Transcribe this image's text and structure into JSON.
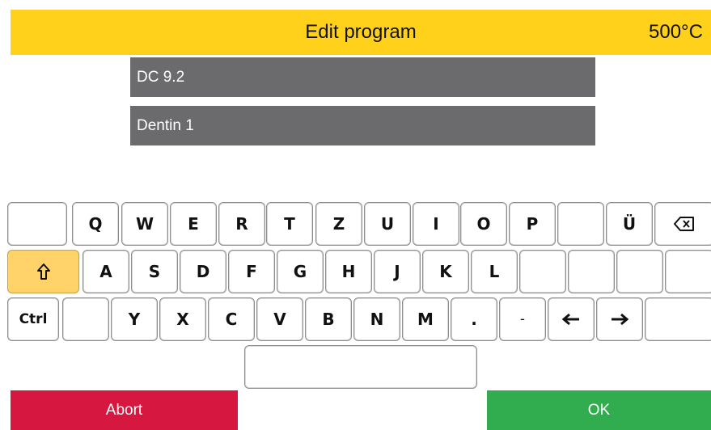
{
  "header": {
    "title": "Edit program",
    "temperature": "500°C",
    "bg_color": "#ffd11a"
  },
  "fields": {
    "line1": "DC 9.2",
    "line2": "Dentin 1"
  },
  "keyboard": {
    "row1": [
      "",
      "Q",
      "W",
      "E",
      "R",
      "T",
      "Z",
      "U",
      "I",
      "O",
      "P",
      "",
      "Ü",
      "⌫"
    ],
    "row2": [
      "⇧",
      "A",
      "S",
      "D",
      "F",
      "G",
      "H",
      "J",
      "K",
      "L",
      "",
      "",
      "",
      ""
    ],
    "row3": [
      "Ctrl",
      "",
      "Y",
      "X",
      "C",
      "V",
      "B",
      "N",
      "M",
      ".",
      "-",
      "←",
      "→",
      ""
    ],
    "space": ""
  },
  "buttons": {
    "abort": "Abort",
    "ok": "OK",
    "abort_color": "#d6173f",
    "ok_color": "#31ad4f"
  },
  "icons": {
    "backspace": "backspace-icon",
    "shift": "shift-up-arrow-icon",
    "left": "left-arrow-icon",
    "right": "right-arrow-icon"
  }
}
